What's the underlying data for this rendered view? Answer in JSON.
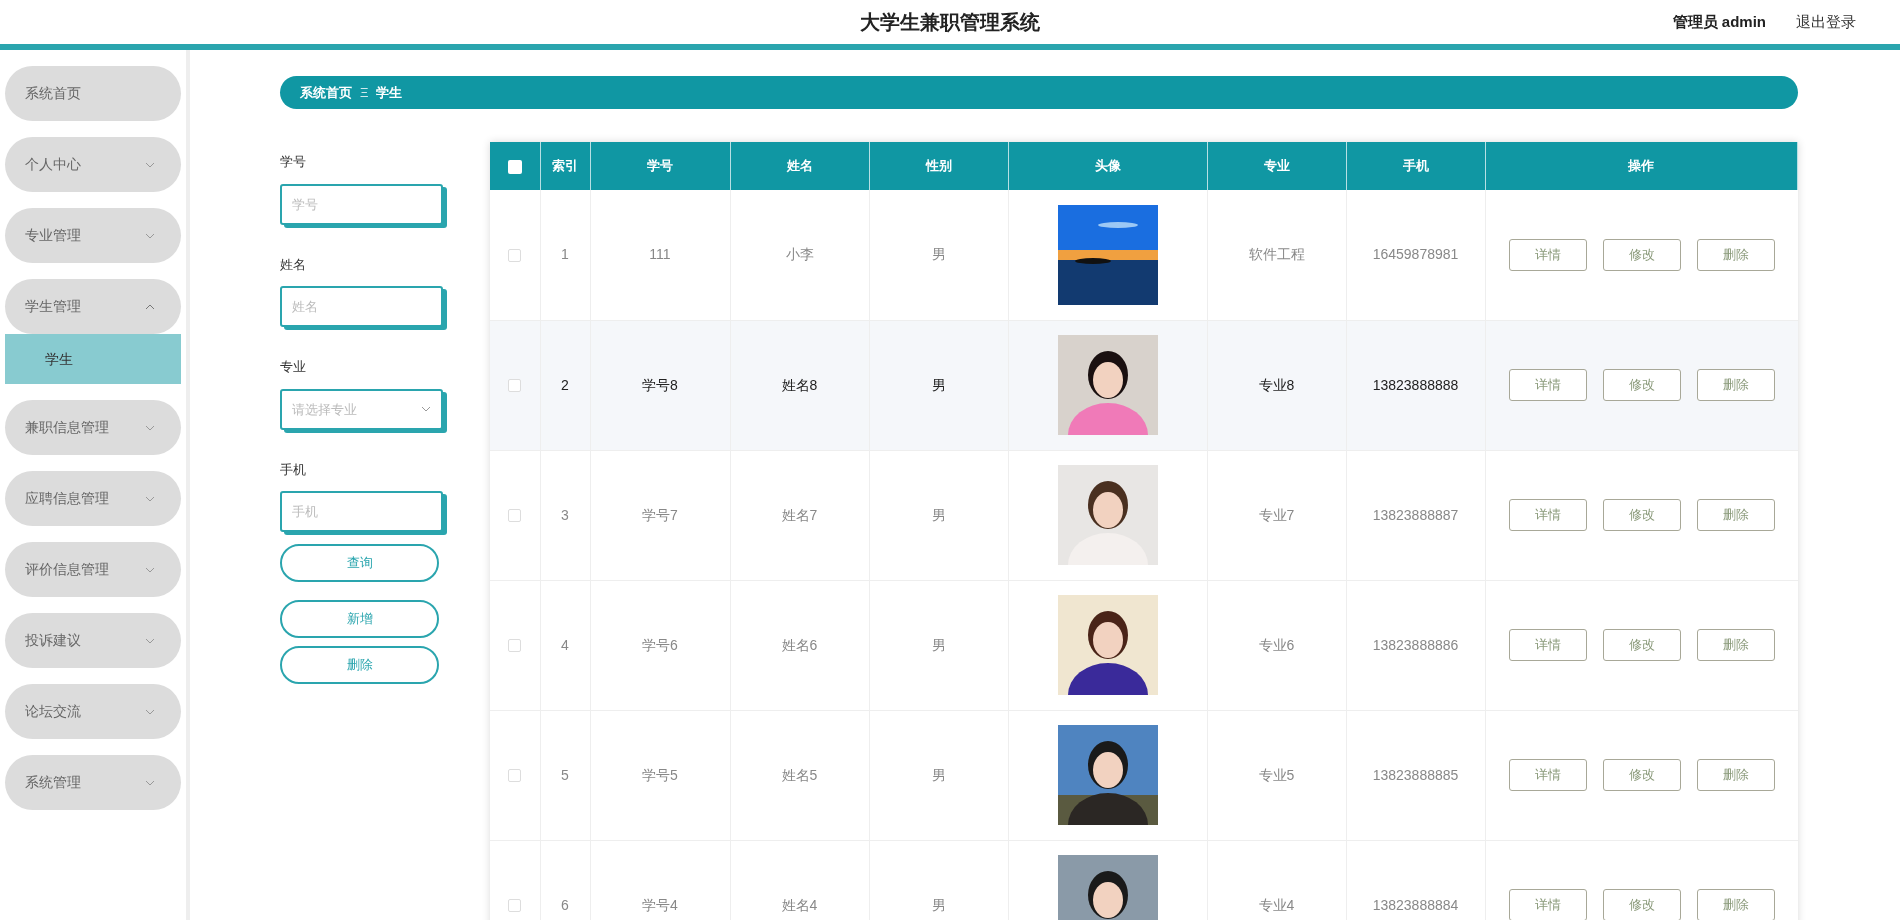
{
  "header": {
    "title": "大学生兼职管理系统",
    "user": "管理员 admin",
    "logout": "退出登录"
  },
  "sidebar": {
    "items": [
      {
        "label": "系统首页",
        "kind": "link"
      },
      {
        "label": "个人中心",
        "kind": "group",
        "expanded": false
      },
      {
        "label": "专业管理",
        "kind": "group",
        "expanded": false
      },
      {
        "label": "学生管理",
        "kind": "group",
        "expanded": true,
        "children": [
          {
            "label": "学生",
            "selected": true
          }
        ]
      },
      {
        "label": "兼职信息管理",
        "kind": "group",
        "expanded": false
      },
      {
        "label": "应聘信息管理",
        "kind": "group",
        "expanded": false
      },
      {
        "label": "评价信息管理",
        "kind": "group",
        "expanded": false
      },
      {
        "label": "投诉建议",
        "kind": "group",
        "expanded": false
      },
      {
        "label": "论坛交流",
        "kind": "group",
        "expanded": false
      },
      {
        "label": "系统管理",
        "kind": "group",
        "expanded": false
      }
    ]
  },
  "breadcrumb": {
    "items": [
      "系统首页",
      "学生"
    ],
    "separator": "Ξ"
  },
  "search_form": {
    "fields": [
      {
        "label": "学号",
        "placeholder": "学号",
        "kind": "text"
      },
      {
        "label": "姓名",
        "placeholder": "姓名",
        "kind": "text"
      },
      {
        "label": "专业",
        "placeholder": "请选择专业",
        "kind": "select"
      },
      {
        "label": "手机",
        "placeholder": "手机",
        "kind": "text"
      }
    ],
    "buttons": [
      "查询",
      "新增",
      "删除"
    ]
  },
  "table": {
    "columns": [
      "索引",
      "学号",
      "姓名",
      "性别",
      "头像",
      "专业",
      "手机",
      "操作"
    ],
    "header_checked": false,
    "rows": [
      {
        "index": "1",
        "student_no": "111",
        "name": "小李",
        "gender": "男",
        "major": "软件工程",
        "phone": "16459878981",
        "checked": false,
        "highlighted": false,
        "actions": [
          "详情",
          "修改",
          "删除"
        ]
      },
      {
        "index": "2",
        "student_no": "学号8",
        "name": "姓名8",
        "gender": "男",
        "major": "专业8",
        "phone": "13823888888",
        "checked": false,
        "highlighted": true,
        "actions": [
          "详情",
          "修改",
          "删除"
        ]
      },
      {
        "index": "3",
        "student_no": "学号7",
        "name": "姓名7",
        "gender": "男",
        "major": "专业7",
        "phone": "13823888887",
        "checked": false,
        "highlighted": false,
        "actions": [
          "详情",
          "修改",
          "删除"
        ]
      },
      {
        "index": "4",
        "student_no": "学号6",
        "name": "姓名6",
        "gender": "男",
        "major": "专业6",
        "phone": "13823888886",
        "checked": false,
        "highlighted": false,
        "actions": [
          "详情",
          "修改",
          "删除"
        ]
      },
      {
        "index": "5",
        "student_no": "学号5",
        "name": "姓名5",
        "gender": "男",
        "major": "专业5",
        "phone": "13823888885",
        "checked": false,
        "highlighted": false,
        "actions": [
          "详情",
          "修改",
          "删除"
        ]
      },
      {
        "index": "6",
        "student_no": "学号4",
        "name": "姓名4",
        "gender": "男",
        "major": "专业4",
        "phone": "13823888884",
        "checked": false,
        "highlighted": false,
        "actions": [
          "详情",
          "修改",
          "删除"
        ]
      }
    ]
  }
}
